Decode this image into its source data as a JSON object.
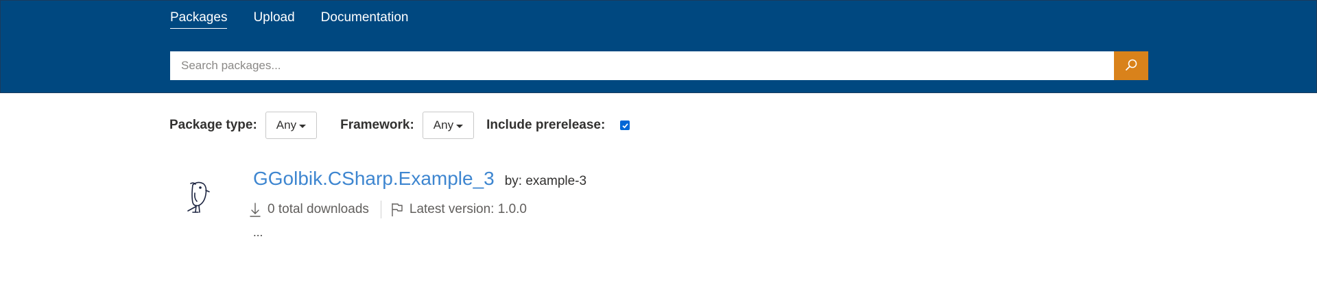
{
  "nav": {
    "items": [
      {
        "label": "Packages",
        "active": true
      },
      {
        "label": "Upload",
        "active": false
      },
      {
        "label": "Documentation",
        "active": false
      }
    ]
  },
  "search": {
    "placeholder": "Search packages...",
    "button_icon": "search-icon"
  },
  "filters": {
    "package_type_label": "Package type:",
    "package_type_value": "Any",
    "framework_label": "Framework:",
    "framework_value": "Any",
    "prerelease_label": "Include prerelease:",
    "prerelease_checked": true
  },
  "package": {
    "icon": "bird-icon",
    "name": "GGolbik.CSharp.Example_3",
    "by": "by: example-3",
    "downloads": "0 total downloads",
    "latest_version": "Latest version: 1.0.0",
    "description": "..."
  },
  "colors": {
    "header_bg": "#004880",
    "search_button": "#d9821b",
    "link": "#3e86d0",
    "checkbox": "#0067d6"
  }
}
